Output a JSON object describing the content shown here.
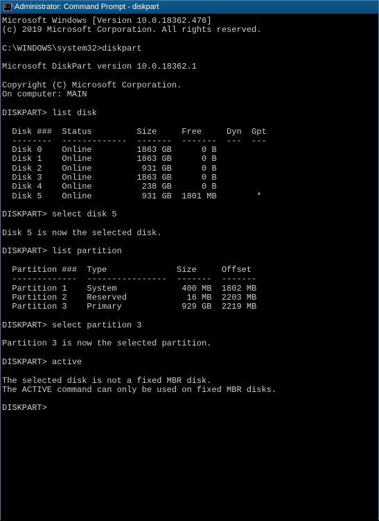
{
  "titlebar": {
    "text": "Administrator: Command Prompt - diskpart",
    "icon_label": "C:\\"
  },
  "terminal": {
    "lines": [
      "Microsoft Windows [Version 10.0.18362.476]",
      "(c) 2019 Microsoft Corporation. All rights reserved.",
      "",
      "C:\\WINDOWS\\system32>diskpart",
      "",
      "Microsoft DiskPart version 10.0.18362.1",
      "",
      "Copyright (C) Microsoft Corporation.",
      "On computer: MAIN",
      "",
      "DISKPART> list disk",
      "",
      "  Disk ###  Status         Size     Free     Dyn  Gpt",
      "  --------  -------------  -------  -------  ---  ---",
      "  Disk 0    Online         1863 GB      0 B",
      "  Disk 1    Online         1863 GB      0 B",
      "  Disk 2    Online          931 GB      0 B",
      "  Disk 3    Online         1863 GB      0 B",
      "  Disk 4    Online          238 GB      0 B",
      "  Disk 5    Online          931 GB  1801 MB        *",
      "",
      "DISKPART> select disk 5",
      "",
      "Disk 5 is now the selected disk.",
      "",
      "DISKPART> list partition",
      "",
      "  Partition ###  Type              Size     Offset",
      "  -------------  ----------------  -------  -------",
      "  Partition 1    System             400 MB  1802 MB",
      "  Partition 2    Reserved            16 MB  2203 MB",
      "  Partition 3    Primary            929 GB  2219 MB",
      "",
      "DISKPART> select partition 3",
      "",
      "Partition 3 is now the selected partition.",
      "",
      "DISKPART> active",
      "",
      "The selected disk is not a fixed MBR disk.",
      "The ACTIVE command can only be used on fixed MBR disks.",
      "",
      "DISKPART>"
    ]
  },
  "disk_table": {
    "headers": [
      "Disk ###",
      "Status",
      "Size",
      "Free",
      "Dyn",
      "Gpt"
    ],
    "rows": [
      {
        "disk": "Disk 0",
        "status": "Online",
        "size": "1863 GB",
        "free": "0 B",
        "dyn": "",
        "gpt": ""
      },
      {
        "disk": "Disk 1",
        "status": "Online",
        "size": "1863 GB",
        "free": "0 B",
        "dyn": "",
        "gpt": ""
      },
      {
        "disk": "Disk 2",
        "status": "Online",
        "size": "931 GB",
        "free": "0 B",
        "dyn": "",
        "gpt": ""
      },
      {
        "disk": "Disk 3",
        "status": "Online",
        "size": "1863 GB",
        "free": "0 B",
        "dyn": "",
        "gpt": ""
      },
      {
        "disk": "Disk 4",
        "status": "Online",
        "size": "238 GB",
        "free": "0 B",
        "dyn": "",
        "gpt": ""
      },
      {
        "disk": "Disk 5",
        "status": "Online",
        "size": "931 GB",
        "free": "1801 MB",
        "dyn": "",
        "gpt": "*"
      }
    ]
  },
  "partition_table": {
    "headers": [
      "Partition ###",
      "Type",
      "Size",
      "Offset"
    ],
    "rows": [
      {
        "partition": "Partition 1",
        "type": "System",
        "size": "400 MB",
        "offset": "1802 MB"
      },
      {
        "partition": "Partition 2",
        "type": "Reserved",
        "size": "16 MB",
        "offset": "2203 MB"
      },
      {
        "partition": "Partition 3",
        "type": "Primary",
        "size": "929 GB",
        "offset": "2219 MB"
      }
    ]
  },
  "commands": [
    {
      "prompt": "C:\\WINDOWS\\system32>",
      "cmd": "diskpart"
    },
    {
      "prompt": "DISKPART>",
      "cmd": "list disk"
    },
    {
      "prompt": "DISKPART>",
      "cmd": "select disk 5"
    },
    {
      "prompt": "DISKPART>",
      "cmd": "list partition"
    },
    {
      "prompt": "DISKPART>",
      "cmd": "select partition 3"
    },
    {
      "prompt": "DISKPART>",
      "cmd": "active"
    },
    {
      "prompt": "DISKPART>",
      "cmd": ""
    }
  ]
}
